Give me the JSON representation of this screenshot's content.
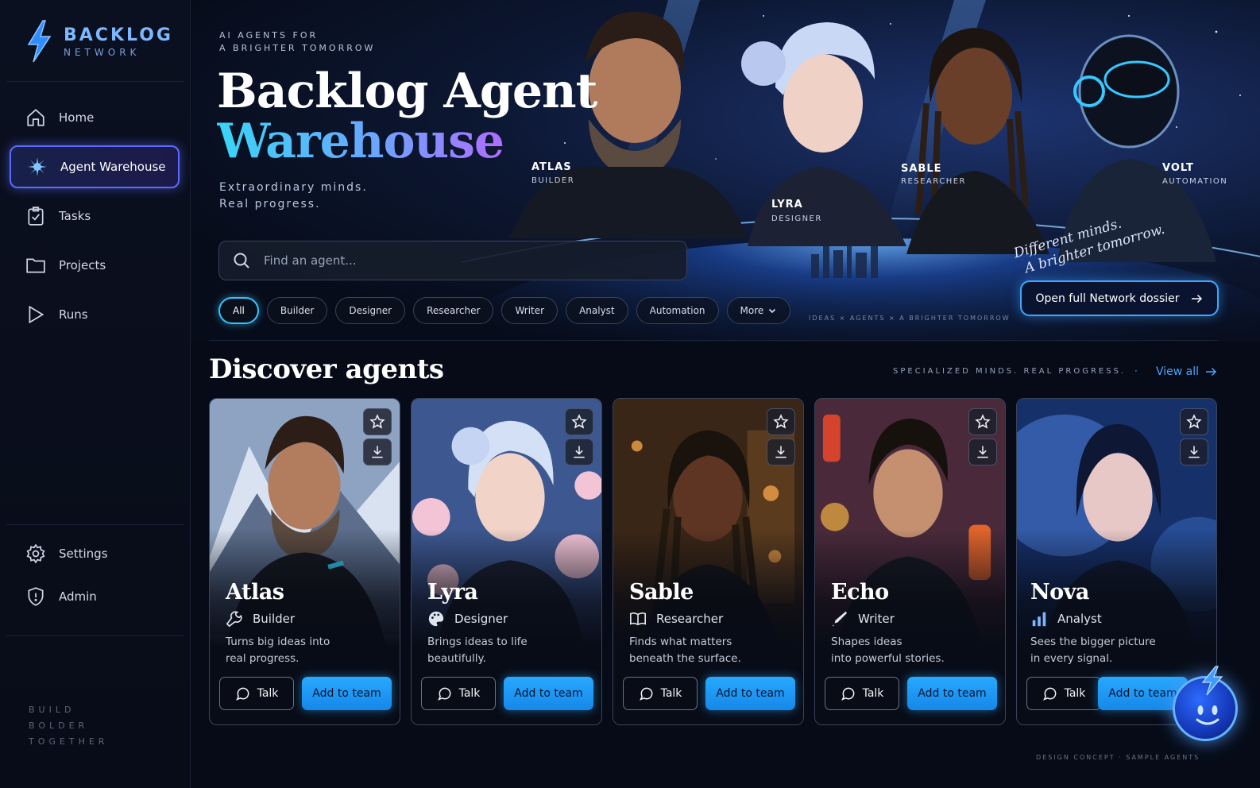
{
  "brand": {
    "name": "BACKLOG",
    "sub": "NETWORK"
  },
  "sidebar": {
    "items": [
      {
        "label": "Home",
        "icon": "home-icon"
      },
      {
        "label": "Agent Warehouse",
        "icon": "sparkle-icon",
        "active": true
      },
      {
        "label": "Tasks",
        "icon": "clipboard-check-icon"
      },
      {
        "label": "Projects",
        "icon": "folder-icon"
      },
      {
        "label": "Runs",
        "icon": "play-icon"
      }
    ],
    "bottom_items": [
      {
        "label": "Settings",
        "icon": "gear-icon"
      },
      {
        "label": "Admin",
        "icon": "shield-icon"
      }
    ],
    "quote": [
      "BUILD",
      "BOLDER",
      "TOGETHER"
    ]
  },
  "hero": {
    "eyebrow": [
      "AI AGENTS FOR",
      "A BRIGHTER TOMORROW"
    ],
    "title_line1": "Backlog Agent",
    "title_line2": "Warehouse",
    "subtitle": [
      "Extraordinary minds.",
      "Real progress."
    ],
    "search_placeholder": "Find an agent...",
    "filters": [
      "All",
      "Builder",
      "Designer",
      "Researcher",
      "Writer",
      "Analyst",
      "Automation",
      "More"
    ],
    "active_filter": "All",
    "characters": [
      {
        "name": "ATLAS",
        "role": "BUILDER"
      },
      {
        "name": "LYRA",
        "role": "DESIGNER"
      },
      {
        "name": "SABLE",
        "role": "RESEARCHER"
      },
      {
        "name": "VOLT",
        "role": "AUTOMATION"
      }
    ],
    "tagline": [
      "Different minds.",
      "A brighter tomorrow."
    ],
    "dossier_label": "Open full Network dossier",
    "meta": "IDEAS × AGENTS × A BRIGHTER TOMORROW"
  },
  "discover": {
    "title": "Discover agents",
    "tagline": "SPECIALIZED MINDS. REAL PROGRESS.",
    "separator": "·",
    "view_all": "View all",
    "talk_label": "Talk",
    "add_label": "Add to team",
    "agents": [
      {
        "name": "Atlas",
        "role": "Builder",
        "role_icon": "wrench-icon",
        "desc": [
          "Turns big ideas into",
          "real progress."
        ]
      },
      {
        "name": "Lyra",
        "role": "Designer",
        "role_icon": "palette-icon",
        "desc": [
          "Brings ideas to life",
          "beautifully."
        ]
      },
      {
        "name": "Sable",
        "role": "Researcher",
        "role_icon": "book-icon",
        "desc": [
          "Finds what matters",
          "beneath the surface."
        ]
      },
      {
        "name": "Echo",
        "role": "Writer",
        "role_icon": "pen-icon",
        "desc": [
          "Shapes ideas",
          "into powerful stories."
        ]
      },
      {
        "name": "Nova",
        "role": "Analyst",
        "role_icon": "bar-chart-icon",
        "desc": [
          "Sees the bigger picture",
          "in every signal."
        ]
      }
    ]
  },
  "footer_note": "DESIGN CONCEPT · SAMPLE AGENTS",
  "colors": {
    "accent": "#27a9ff",
    "active_nav": "#5b6bff",
    "background": "#060b17"
  }
}
